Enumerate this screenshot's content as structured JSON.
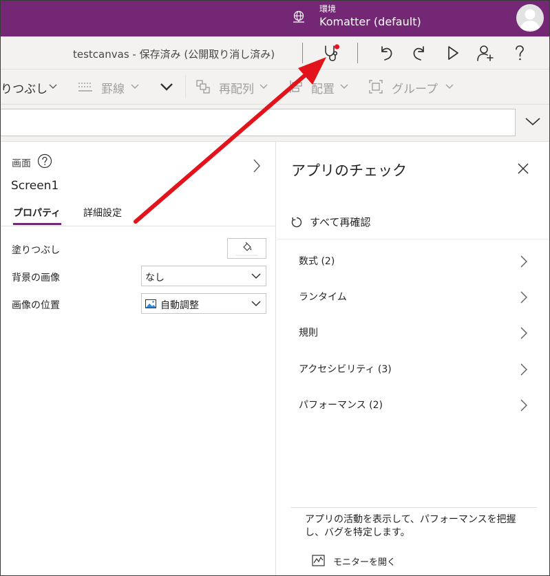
{
  "topbar": {
    "env_label": "環境",
    "env_name": "Komatter (default)"
  },
  "cmdbar": {
    "doc_title": "testcanvas - 保存済み (公開取り消し済み)",
    "icons": [
      "app-checker-icon",
      "undo-icon",
      "redo-icon",
      "play-icon",
      "share-user-icon",
      "help-icon"
    ],
    "checker_notification_color": "#e81123"
  },
  "toolbar": {
    "fill": "りつぶし",
    "border": "罫線",
    "reorder": "再配列",
    "align": "配置",
    "group": "グループ"
  },
  "properties": {
    "kind": "画面",
    "name": "Screen1",
    "tabs": {
      "properties": "プロパティ",
      "advanced": "詳細設定"
    },
    "fill_label": "塗りつぶし",
    "bg_image_label": "背景の画像",
    "bg_image_value": "なし",
    "image_position_label": "画像の位置",
    "image_position_value": "自動調整"
  },
  "checker": {
    "title": "アプリのチェック",
    "recheck": "すべて再確認",
    "categories": [
      {
        "label": "数式 (2)"
      },
      {
        "label": "ランタイム"
      },
      {
        "label": "規則"
      },
      {
        "label": "アクセシビリティ (3)"
      },
      {
        "label": "パフォーマンス (2)"
      }
    ],
    "monitor_desc": "アプリの活動を表示して、パフォーマンスを把握し、バグを特定します。",
    "monitor_link": "モニターを開く"
  },
  "colors": {
    "brand": "#742774",
    "annotation_arrow": "#e3131b"
  }
}
